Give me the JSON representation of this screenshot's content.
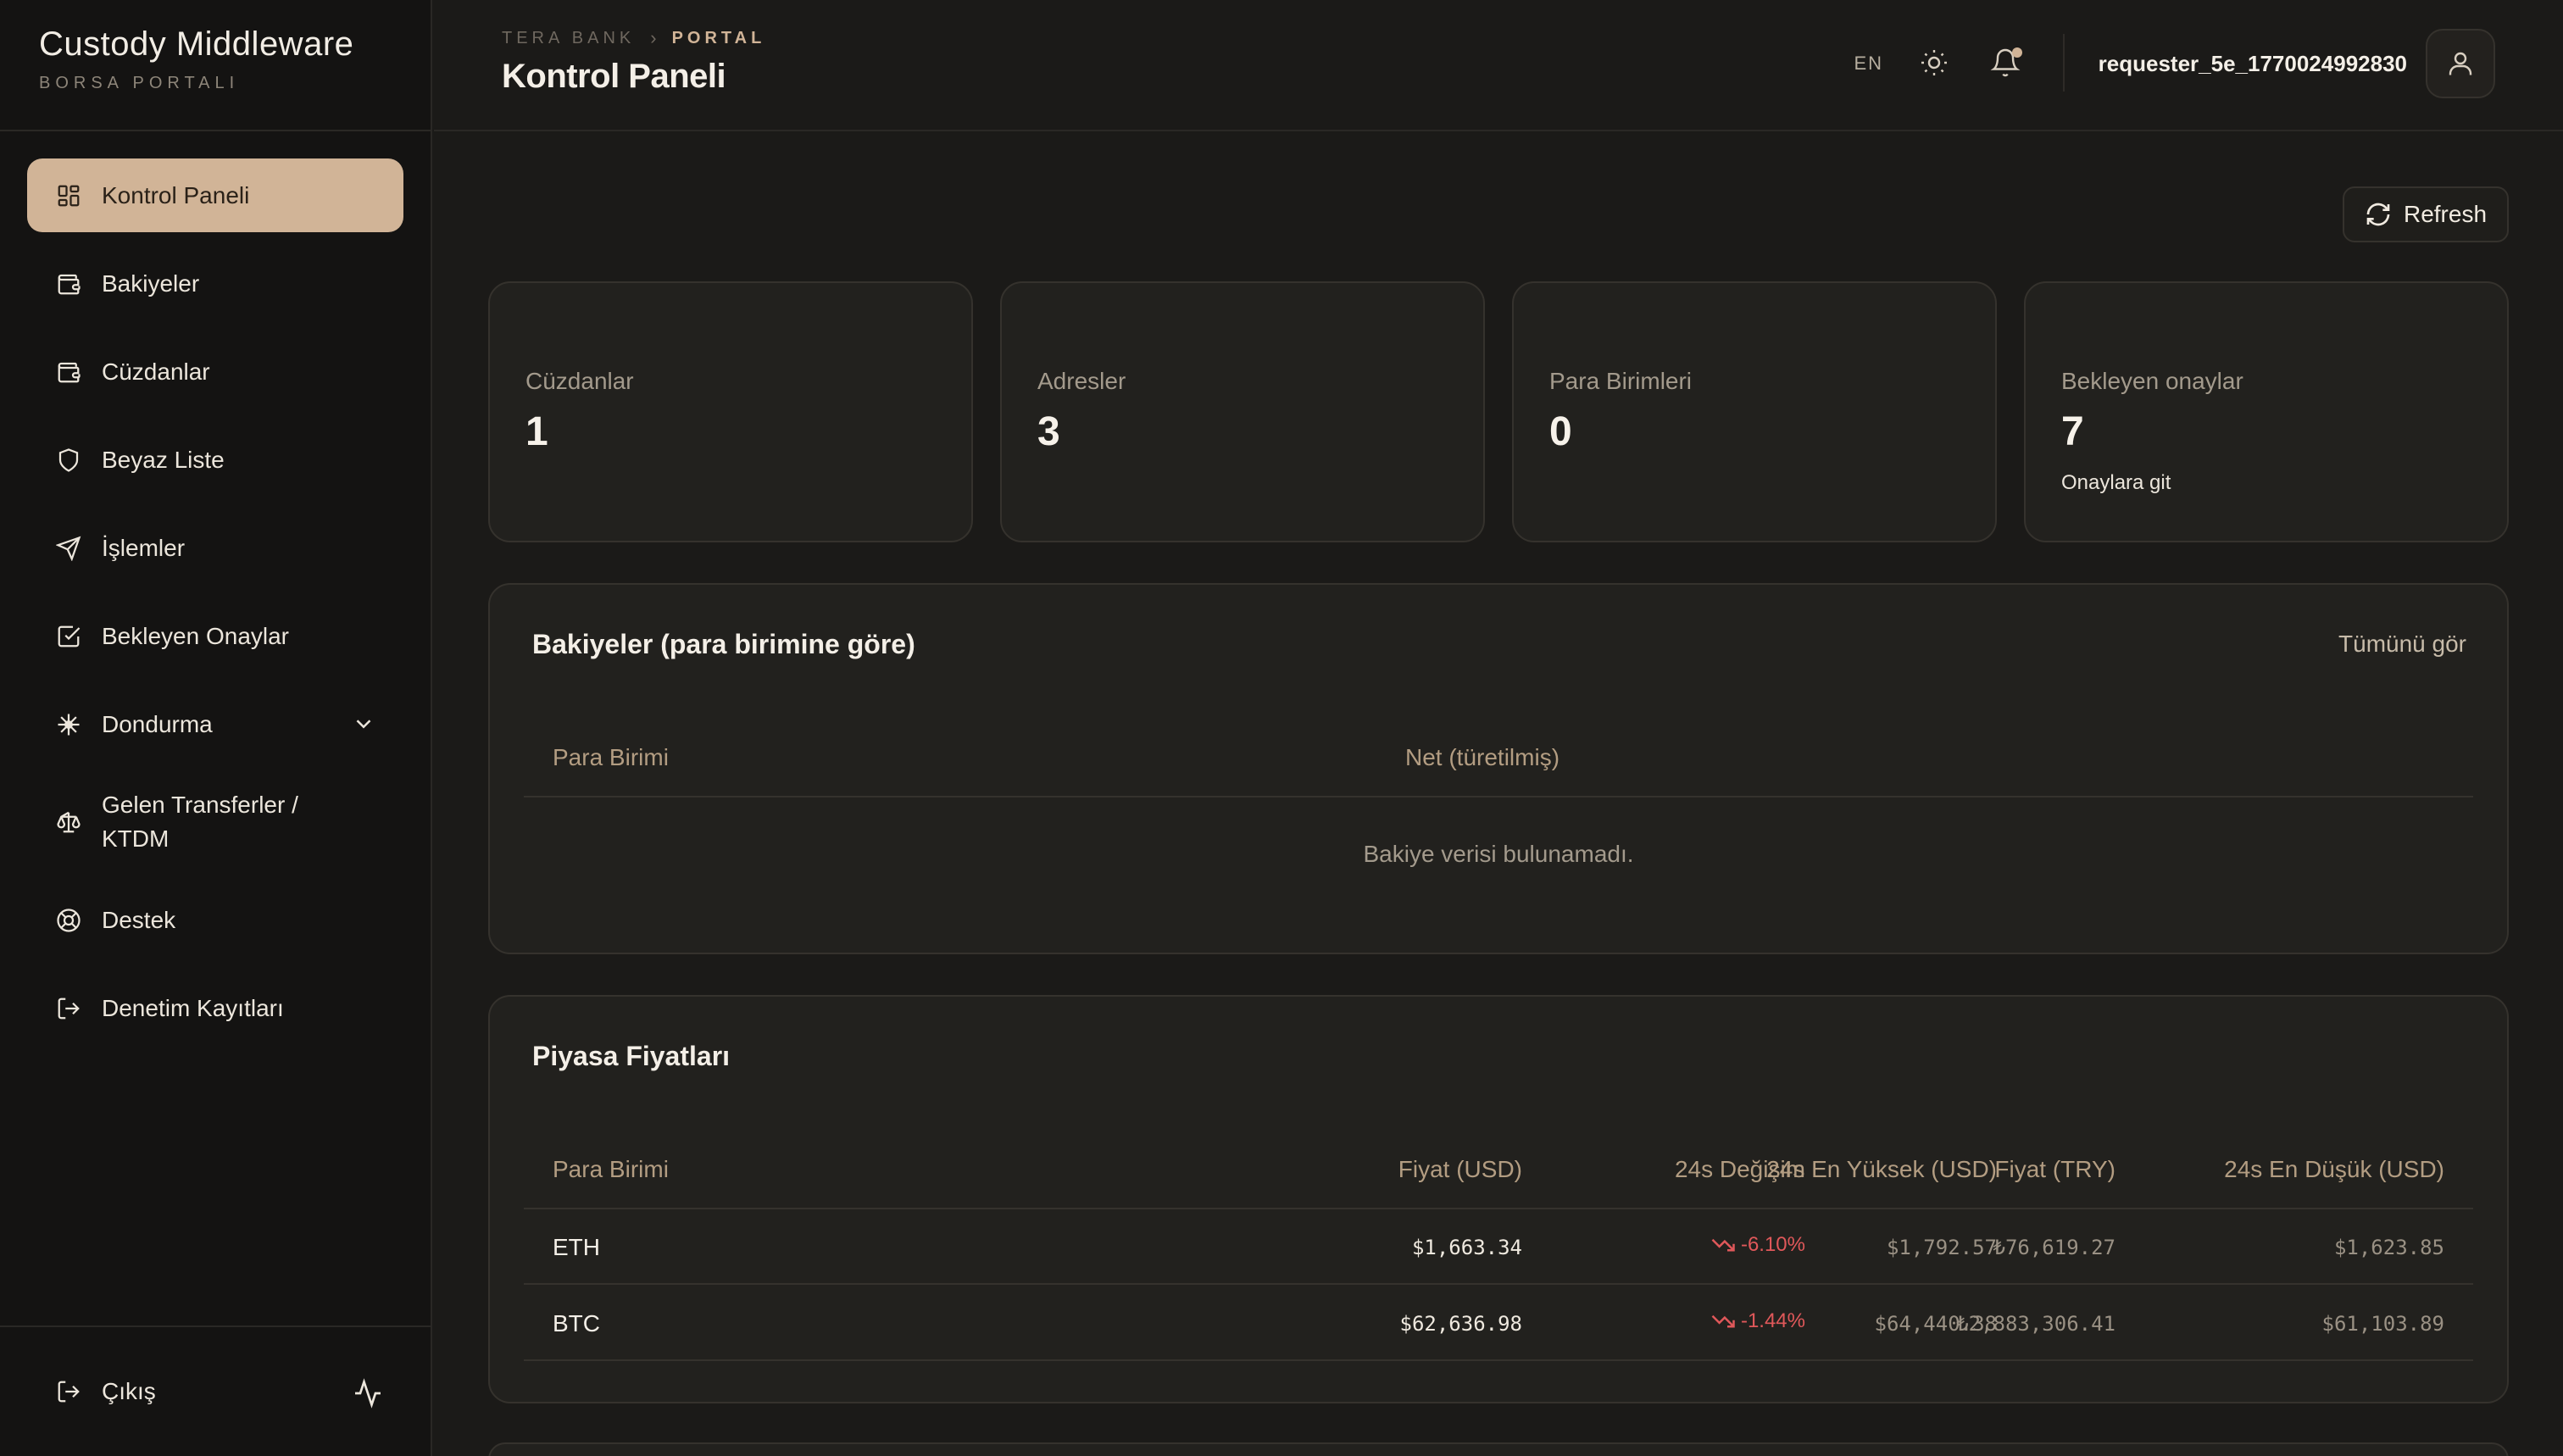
{
  "brand": {
    "title": "Custody Middleware",
    "subtitle": "BORSA PORTALI"
  },
  "sidebar": {
    "items": [
      {
        "label": "Kontrol Paneli",
        "icon": "dashboard-icon",
        "active": true
      },
      {
        "label": "Bakiyeler",
        "icon": "wallet-icon"
      },
      {
        "label": "Cüzdanlar",
        "icon": "wallet-icon"
      },
      {
        "label": "Beyaz Liste",
        "icon": "shield-icon"
      },
      {
        "label": "İşlemler",
        "icon": "send-icon"
      },
      {
        "label": "Bekleyen Onaylar",
        "icon": "check-square-icon"
      },
      {
        "label": "Dondurma",
        "icon": "snowflake-icon",
        "expandable": true
      },
      {
        "label": "Gelen Transferler / KTDM",
        "icon": "scale-icon"
      },
      {
        "label": "Destek",
        "icon": "lifebuoy-icon"
      },
      {
        "label": "Denetim Kayıtları",
        "icon": "log-out-icon"
      }
    ],
    "logout_label": "Çıkış"
  },
  "header": {
    "breadcrumb": {
      "root": "TERA BANK",
      "current": "PORTAL"
    },
    "title": "Kontrol Paneli",
    "language": "EN",
    "username": "requester_5e_1770024992830"
  },
  "toolbar": {
    "refresh_label": "Refresh"
  },
  "stats": [
    {
      "label": "Cüzdanlar",
      "value": "1"
    },
    {
      "label": "Adresler",
      "value": "3"
    },
    {
      "label": "Para Birimleri",
      "value": "0"
    },
    {
      "label": "Bekleyen onaylar",
      "value": "7",
      "link": "Onaylara git"
    }
  ],
  "balances": {
    "title": "Bakiyeler (para birimine göre)",
    "see_all": "Tümünü gör",
    "columns": [
      "Para Birimi",
      "Net (türetilmiş)"
    ],
    "empty": "Bakiye verisi bulunamadı."
  },
  "market": {
    "title": "Piyasa Fiyatları",
    "columns": [
      "Para Birimi",
      "Fiyat (USD)",
      "24s Değişim",
      "Fiyat (TRY)",
      "24s En Yüksek (USD)",
      "24s En Düşük (USD)"
    ],
    "rows": [
      {
        "symbol": "ETH",
        "price_usd": "$1,663.34",
        "change": "-6.10%",
        "price_try": "₺76,619.27",
        "high": "$1,792.57",
        "low": "$1,623.85"
      },
      {
        "symbol": "BTC",
        "price_usd": "$62,636.98",
        "change": "-1.44%",
        "price_try": "₺2,883,306.41",
        "high": "$64,440.38",
        "low": "$61,103.89"
      }
    ]
  },
  "colors": {
    "accent": "#d1b497",
    "negative": "#e0585a",
    "background": "#1b1a18",
    "card": "#22211e"
  }
}
